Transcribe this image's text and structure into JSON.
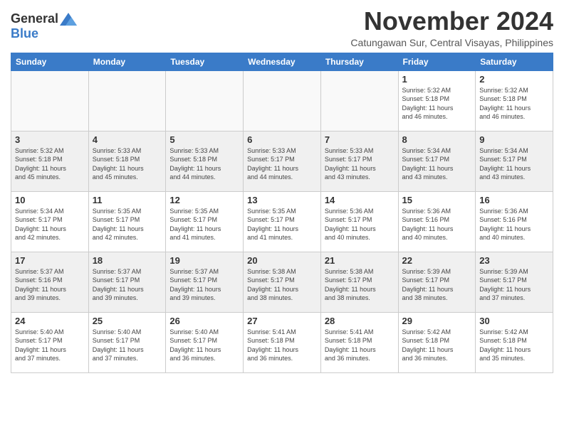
{
  "header": {
    "logo_general": "General",
    "logo_blue": "Blue",
    "month_title": "November 2024",
    "location": "Catungawan Sur, Central Visayas, Philippines"
  },
  "weekdays": [
    "Sunday",
    "Monday",
    "Tuesday",
    "Wednesday",
    "Thursday",
    "Friday",
    "Saturday"
  ],
  "weeks": [
    [
      {
        "day": "",
        "info": ""
      },
      {
        "day": "",
        "info": ""
      },
      {
        "day": "",
        "info": ""
      },
      {
        "day": "",
        "info": ""
      },
      {
        "day": "",
        "info": ""
      },
      {
        "day": "1",
        "info": "Sunrise: 5:32 AM\nSunset: 5:18 PM\nDaylight: 11 hours\nand 46 minutes."
      },
      {
        "day": "2",
        "info": "Sunrise: 5:32 AM\nSunset: 5:18 PM\nDaylight: 11 hours\nand 46 minutes."
      }
    ],
    [
      {
        "day": "3",
        "info": "Sunrise: 5:32 AM\nSunset: 5:18 PM\nDaylight: 11 hours\nand 45 minutes."
      },
      {
        "day": "4",
        "info": "Sunrise: 5:33 AM\nSunset: 5:18 PM\nDaylight: 11 hours\nand 45 minutes."
      },
      {
        "day": "5",
        "info": "Sunrise: 5:33 AM\nSunset: 5:18 PM\nDaylight: 11 hours\nand 44 minutes."
      },
      {
        "day": "6",
        "info": "Sunrise: 5:33 AM\nSunset: 5:17 PM\nDaylight: 11 hours\nand 44 minutes."
      },
      {
        "day": "7",
        "info": "Sunrise: 5:33 AM\nSunset: 5:17 PM\nDaylight: 11 hours\nand 43 minutes."
      },
      {
        "day": "8",
        "info": "Sunrise: 5:34 AM\nSunset: 5:17 PM\nDaylight: 11 hours\nand 43 minutes."
      },
      {
        "day": "9",
        "info": "Sunrise: 5:34 AM\nSunset: 5:17 PM\nDaylight: 11 hours\nand 43 minutes."
      }
    ],
    [
      {
        "day": "10",
        "info": "Sunrise: 5:34 AM\nSunset: 5:17 PM\nDaylight: 11 hours\nand 42 minutes."
      },
      {
        "day": "11",
        "info": "Sunrise: 5:35 AM\nSunset: 5:17 PM\nDaylight: 11 hours\nand 42 minutes."
      },
      {
        "day": "12",
        "info": "Sunrise: 5:35 AM\nSunset: 5:17 PM\nDaylight: 11 hours\nand 41 minutes."
      },
      {
        "day": "13",
        "info": "Sunrise: 5:35 AM\nSunset: 5:17 PM\nDaylight: 11 hours\nand 41 minutes."
      },
      {
        "day": "14",
        "info": "Sunrise: 5:36 AM\nSunset: 5:17 PM\nDaylight: 11 hours\nand 40 minutes."
      },
      {
        "day": "15",
        "info": "Sunrise: 5:36 AM\nSunset: 5:16 PM\nDaylight: 11 hours\nand 40 minutes."
      },
      {
        "day": "16",
        "info": "Sunrise: 5:36 AM\nSunset: 5:16 PM\nDaylight: 11 hours\nand 40 minutes."
      }
    ],
    [
      {
        "day": "17",
        "info": "Sunrise: 5:37 AM\nSunset: 5:16 PM\nDaylight: 11 hours\nand 39 minutes."
      },
      {
        "day": "18",
        "info": "Sunrise: 5:37 AM\nSunset: 5:17 PM\nDaylight: 11 hours\nand 39 minutes."
      },
      {
        "day": "19",
        "info": "Sunrise: 5:37 AM\nSunset: 5:17 PM\nDaylight: 11 hours\nand 39 minutes."
      },
      {
        "day": "20",
        "info": "Sunrise: 5:38 AM\nSunset: 5:17 PM\nDaylight: 11 hours\nand 38 minutes."
      },
      {
        "day": "21",
        "info": "Sunrise: 5:38 AM\nSunset: 5:17 PM\nDaylight: 11 hours\nand 38 minutes."
      },
      {
        "day": "22",
        "info": "Sunrise: 5:39 AM\nSunset: 5:17 PM\nDaylight: 11 hours\nand 38 minutes."
      },
      {
        "day": "23",
        "info": "Sunrise: 5:39 AM\nSunset: 5:17 PM\nDaylight: 11 hours\nand 37 minutes."
      }
    ],
    [
      {
        "day": "24",
        "info": "Sunrise: 5:40 AM\nSunset: 5:17 PM\nDaylight: 11 hours\nand 37 minutes."
      },
      {
        "day": "25",
        "info": "Sunrise: 5:40 AM\nSunset: 5:17 PM\nDaylight: 11 hours\nand 37 minutes."
      },
      {
        "day": "26",
        "info": "Sunrise: 5:40 AM\nSunset: 5:17 PM\nDaylight: 11 hours\nand 36 minutes."
      },
      {
        "day": "27",
        "info": "Sunrise: 5:41 AM\nSunset: 5:18 PM\nDaylight: 11 hours\nand 36 minutes."
      },
      {
        "day": "28",
        "info": "Sunrise: 5:41 AM\nSunset: 5:18 PM\nDaylight: 11 hours\nand 36 minutes."
      },
      {
        "day": "29",
        "info": "Sunrise: 5:42 AM\nSunset: 5:18 PM\nDaylight: 11 hours\nand 36 minutes."
      },
      {
        "day": "30",
        "info": "Sunrise: 5:42 AM\nSunset: 5:18 PM\nDaylight: 11 hours\nand 35 minutes."
      }
    ]
  ]
}
